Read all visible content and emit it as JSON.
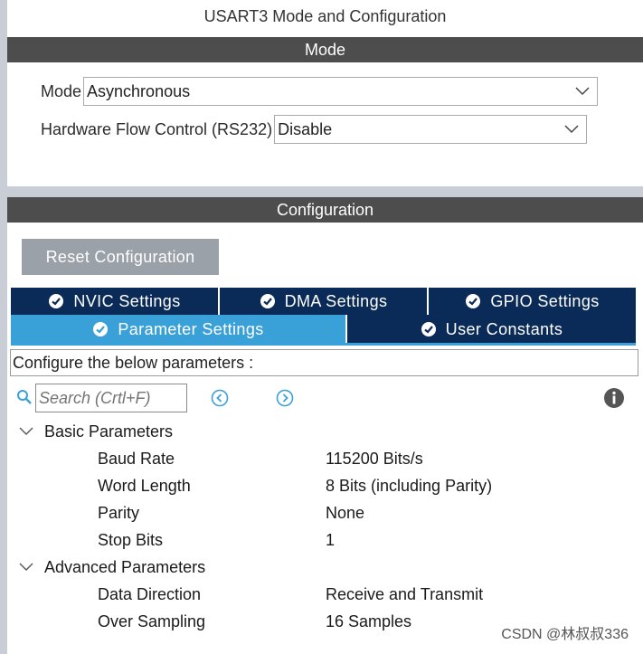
{
  "window_title": "USART3 Mode and Configuration",
  "mode_section": {
    "header": "Mode",
    "mode_label": "Mode",
    "mode_value": "Asynchronous",
    "hfc_label": "Hardware Flow Control (RS232)",
    "hfc_value": "Disable"
  },
  "config_section": {
    "header": "Configuration",
    "reset_button": "Reset Configuration",
    "tabs_row1": [
      "NVIC Settings",
      "DMA Settings",
      "GPIO Settings"
    ],
    "tabs_row2": [
      "Parameter Settings",
      "User Constants"
    ],
    "active_tab": "Parameter Settings",
    "description": "Configure the below parameters :",
    "search_placeholder": "Search (Crtl+F)",
    "groups": [
      {
        "name": "Basic Parameters",
        "items": [
          {
            "key": "Baud Rate",
            "value": "115200 Bits/s"
          },
          {
            "key": "Word Length",
            "value": "8 Bits (including Parity)"
          },
          {
            "key": "Parity",
            "value": "None"
          },
          {
            "key": "Stop Bits",
            "value": "1"
          }
        ]
      },
      {
        "name": "Advanced Parameters",
        "items": [
          {
            "key": "Data Direction",
            "value": "Receive and Transmit"
          },
          {
            "key": "Over Sampling",
            "value": "16 Samples"
          }
        ]
      }
    ]
  },
  "watermark": "CSDN @林叔叔336",
  "colors": {
    "header_bg": "#4d4d4d",
    "tab_bg": "#0a2b58",
    "tab_active_bg": "#3aa1d8",
    "reset_bg": "#9ba1a8",
    "nav_icon": "#3aa1d8"
  }
}
